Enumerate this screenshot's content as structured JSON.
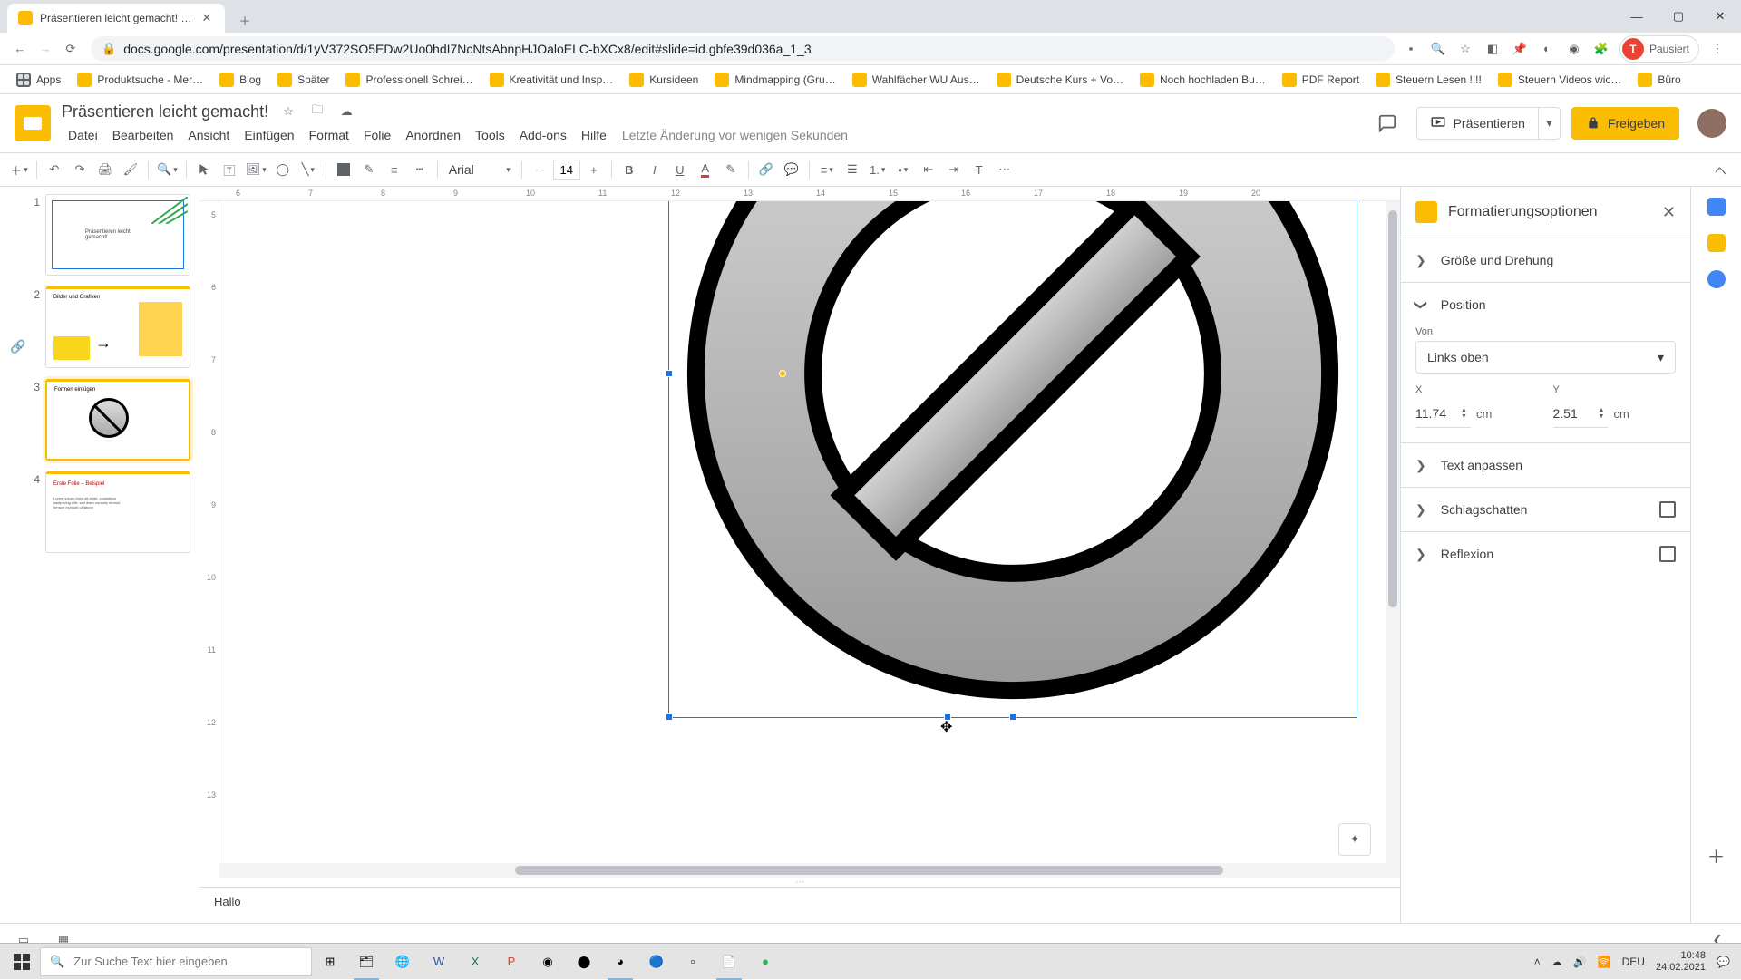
{
  "browser": {
    "tab_title": "Präsentieren leicht gemacht! - G",
    "url": "docs.google.com/presentation/d/1yV372SO5EDw2Uo0hdI7NcNtsAbnpHJOaloELC-bXCx8/edit#slide=id.gbfe39d036a_1_3",
    "profile_state": "Pausiert"
  },
  "bookmarks": [
    "Apps",
    "Produktsuche - Mer…",
    "Blog",
    "Später",
    "Professionell Schrei…",
    "Kreativität und Insp…",
    "Kursideen",
    "Mindmapping  (Gru…",
    "Wahlfächer WU Aus…",
    "Deutsche Kurs + Vo…",
    "Noch hochladen Bu…",
    "PDF Report",
    "Steuern Lesen !!!!",
    "Steuern Videos wic…",
    "Büro"
  ],
  "doc": {
    "title": "Präsentieren leicht gemacht!",
    "last_edit": "Letzte Änderung vor wenigen Sekunden",
    "present": "Präsentieren",
    "share": "Freigeben"
  },
  "menus": [
    "Datei",
    "Bearbeiten",
    "Ansicht",
    "Einfügen",
    "Format",
    "Folie",
    "Anordnen",
    "Tools",
    "Add-ons",
    "Hilfe"
  ],
  "toolbar": {
    "font_family": "Arial",
    "font_size": "14"
  },
  "ruler_h": [
    "6",
    "7",
    "8",
    "9",
    "10",
    "11",
    "12",
    "13",
    "14",
    "15",
    "16",
    "17",
    "18",
    "19",
    "20"
  ],
  "ruler_v": [
    "5",
    "6",
    "7",
    "8",
    "9",
    "10",
    "11",
    "12",
    "13"
  ],
  "slides": {
    "s1": "Präsentieren leicht gemacht!",
    "s2": "Bilder und Grafiken",
    "s3": "Formen einfügen",
    "s4t": "Erste Folie – Beispiel"
  },
  "notes": "Hallo",
  "format_panel": {
    "title": "Formatierungsoptionen",
    "size_rotation": "Größe und Drehung",
    "position": "Position",
    "from_label": "Von",
    "from_value": "Links oben",
    "x_label": "X",
    "y_label": "Y",
    "x_value": "11.74",
    "y_value": "2.51",
    "unit": "cm",
    "text_fit": "Text anpassen",
    "drop_shadow": "Schlagschatten",
    "reflection": "Reflexion"
  },
  "taskbar": {
    "search_placeholder": "Zur Suche Text hier eingeben",
    "lang": "DEU",
    "time": "10:48",
    "date": "24.02.2021"
  }
}
